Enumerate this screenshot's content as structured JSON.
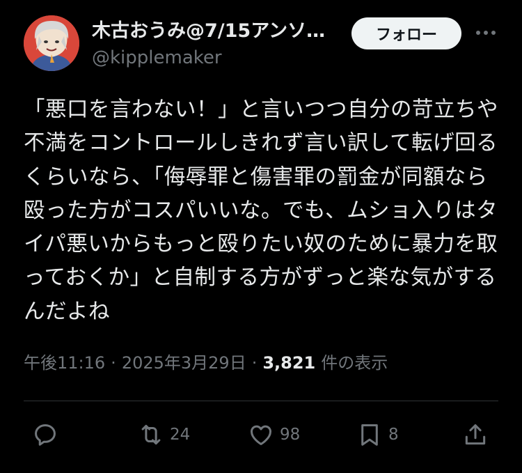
{
  "author": {
    "display_name": "木古おうみ@7/15アンソ…",
    "handle": "@kipplemaker"
  },
  "header": {
    "follow_label": "フォロー"
  },
  "tweet": {
    "text": "「悪口を言わない！」と言いつつ自分の苛立ちや不満をコントロールしきれず言い訳して転げ回るくらいなら、「侮辱罪と傷害罪の罰金が同額なら殴った方がコスパいいな。でも、ムショ入りはタイパ悪いからもっと殴りたい奴のために暴力を取っておくか」と自制する方がずっと楽な気がするんだよね"
  },
  "meta": {
    "time": "午後11:16",
    "separator": "·",
    "date": "2025年3月29日",
    "views_count": "3,821",
    "views_label": "件の表示"
  },
  "actions": {
    "reply": {
      "icon": "reply-icon",
      "count": ""
    },
    "retweet": {
      "icon": "retweet-icon",
      "count": "24"
    },
    "like": {
      "icon": "heart-icon",
      "count": "98"
    },
    "bookmark": {
      "icon": "bookmark-icon",
      "count": "8"
    },
    "share": {
      "icon": "share-icon",
      "count": ""
    }
  },
  "colors": {
    "background": "#000000",
    "text_primary": "#e7e9ea",
    "text_secondary": "#71767b",
    "divider": "#2f3336",
    "follow_button_bg": "#eff3f4"
  }
}
